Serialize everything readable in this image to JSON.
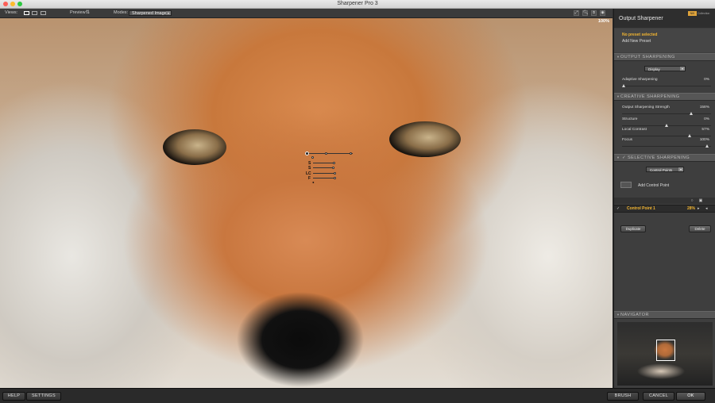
{
  "window": {
    "title": "Sharpener Pro 3"
  },
  "toolbar": {
    "views_label": "Views:",
    "preview_label": "Preview:",
    "modes_label": "Modes:",
    "mode_value": "Sharpened Image",
    "zoom_level": "100%"
  },
  "control_point_overlay": {
    "labels": [
      "S",
      "S",
      "LC",
      "F"
    ]
  },
  "panel": {
    "title": "Output Sharpener",
    "brand": "NIK",
    "brand_text": "Collection",
    "preset": {
      "status": "No preset selected",
      "add": "Add New Preset"
    },
    "output_sharpening": {
      "header": "OUTPUT SHARPENING",
      "select_value": "Display",
      "adaptive_label": "Adaptive Sharpening",
      "adaptive_value": "0%",
      "adaptive_fraction": 0
    },
    "creative_sharpening": {
      "header": "CREATIVE SHARPENING",
      "sliders": [
        {
          "label": "Output Sharpening Strength",
          "value": "158%",
          "fraction": 0.79
        },
        {
          "label": "Structure",
          "value": "0%",
          "fraction": 0.5
        },
        {
          "label": "Local Contrast",
          "value": "57%",
          "fraction": 0.78
        },
        {
          "label": "Focus",
          "value": "100%",
          "fraction": 0.98
        }
      ]
    },
    "selective_sharpening": {
      "header": "SELECTIVE SHARPENING",
      "select_value": "Control Points",
      "add_label": "Add Control Point",
      "items": [
        {
          "check": "✓",
          "name": "Control Point 1",
          "percent": "28%"
        }
      ],
      "duplicate_label": "Duplicate",
      "delete_label": "Delete"
    },
    "navigator": {
      "header": "NAVIGATOR"
    }
  },
  "bottom": {
    "help": "HELP",
    "settings": "SETTINGS",
    "brush": "BRUSH",
    "cancel": "CANCEL",
    "ok": "OK"
  }
}
